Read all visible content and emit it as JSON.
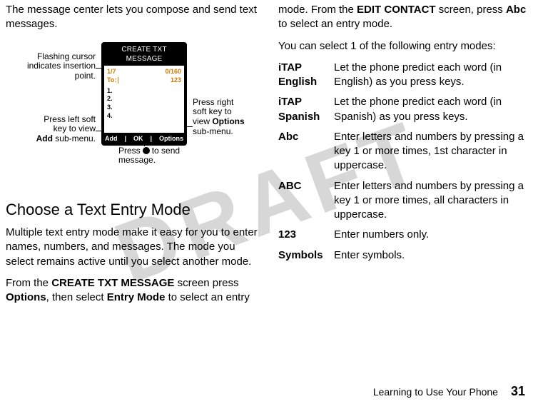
{
  "watermark": "DRAFT",
  "left": {
    "intro": "The message center lets you compose and send text messages.",
    "callouts": {
      "cursor": "Flashing cursor indicates insertion point.",
      "leftsoft_l1": "Press left soft",
      "leftsoft_l2": "key to view",
      "leftsoft_label": "Add",
      "leftsoft_l3": " sub-menu.",
      "rightsoft_l1": "Press right",
      "rightsoft_l2": "soft key to",
      "rightsoft_l3": "view ",
      "rightsoft_label": "Options",
      "rightsoft_l4": "sub-menu.",
      "center_l1": "Press ",
      "center_l2": " to send",
      "center_l3": "message."
    },
    "phone": {
      "title": "CREATE TXT MESSAGE",
      "counter": "1/7",
      "limit": "0/160",
      "to": "To:",
      "mode": "123",
      "lines": [
        "1.",
        "2.",
        "3.",
        "4."
      ],
      "soft_left": "Add",
      "soft_mid": "OK",
      "soft_right": "Options"
    },
    "h2": "Choose a Text Entry Mode",
    "p_multi": "Multiple text entry mode make it easy for you to enter names, numbers, and messages. The mode you select remains active until you select another mode.",
    "p_from_a": "From the ",
    "p_from_screen": "CREATE TXT MESSAGE",
    "p_from_b": " screen press ",
    "p_from_options": "Options",
    "p_from_c": ", then select ",
    "p_from_entry": "Entry Mode",
    "p_from_d": " to select an entry"
  },
  "right": {
    "cont_a": "mode. From the ",
    "cont_edit": "EDIT CONTACT",
    "cont_b": " screen, press ",
    "cont_abc": "Abc",
    "cont_c": " to select an entry mode.",
    "select1": "You can select 1 of the following entry modes:",
    "modes": [
      {
        "label": "iTAP English",
        "desc": "Let the phone predict each word (in English) as you press keys."
      },
      {
        "label": "iTAP Spanish",
        "desc": "Let the phone predict each word (in Spanish) as you press keys."
      },
      {
        "label": "Abc",
        "desc": "Enter letters and numbers by pressing a key 1 or more times, 1st character in uppercase."
      },
      {
        "label": "ABC",
        "desc": "Enter letters and numbers by pressing a key 1 or more times, all characters in uppercase."
      },
      {
        "label": "123",
        "desc": "Enter numbers only."
      },
      {
        "label": "Symbols",
        "desc": "Enter symbols."
      }
    ]
  },
  "footer": {
    "title": "Learning to Use Your Phone",
    "page": "31"
  }
}
